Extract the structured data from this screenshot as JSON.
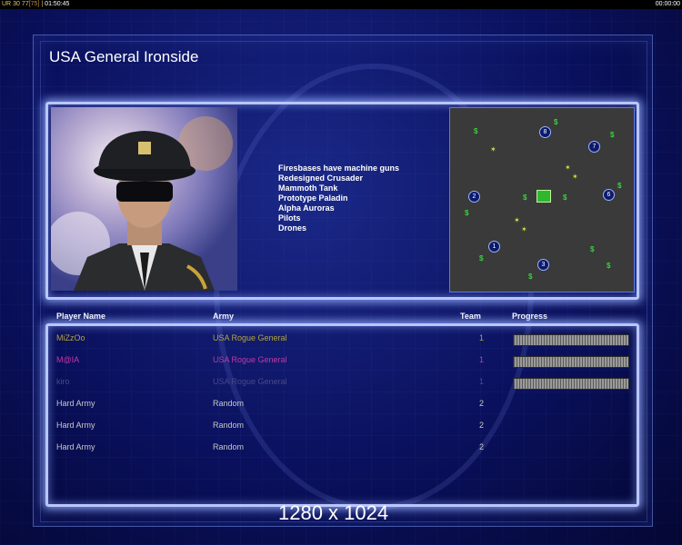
{
  "topbar": {
    "seg1": "UR",
    "seg2": "30",
    "seg3": "77",
    "seg4": "[75]",
    "clock": "01:50:45",
    "right_clock": "00:00:00"
  },
  "title": "USA General Ironside",
  "features": [
    "Firesbases have machine guns",
    "Redesigned Crusader",
    "Mammoth Tank",
    "Prototype Paladin",
    "Alpha Auroras",
    "Pilots",
    "Drones"
  ],
  "minimap": {
    "start_positions": [
      "1",
      "2",
      "3",
      "6",
      "7",
      "8"
    ]
  },
  "columns": {
    "player": "Player Name",
    "army": "Army",
    "team": "Team",
    "progress": "Progress"
  },
  "players": [
    {
      "name": "MiZzOo",
      "army": "USA Rogue General",
      "team": "1",
      "color": "#b5a43a",
      "progress": 1.0
    },
    {
      "name": "M@IA",
      "army": "USA Rogue General",
      "team": "1",
      "color": "#c13aa6",
      "progress": 1.0
    },
    {
      "name": "kiro",
      "army": "USA Rogue General",
      "team": "1",
      "color": "#4a4a86",
      "progress": 1.0
    },
    {
      "name": "Hard Army",
      "army": "Random",
      "team": "2",
      "color": "#c9c9c9"
    },
    {
      "name": "Hard Army",
      "army": "Random",
      "team": "2",
      "color": "#c9c9c9"
    },
    {
      "name": "Hard Army",
      "army": "Random",
      "team": "2",
      "color": "#c9c9c9"
    }
  ],
  "resolution": "1280 x 1024"
}
